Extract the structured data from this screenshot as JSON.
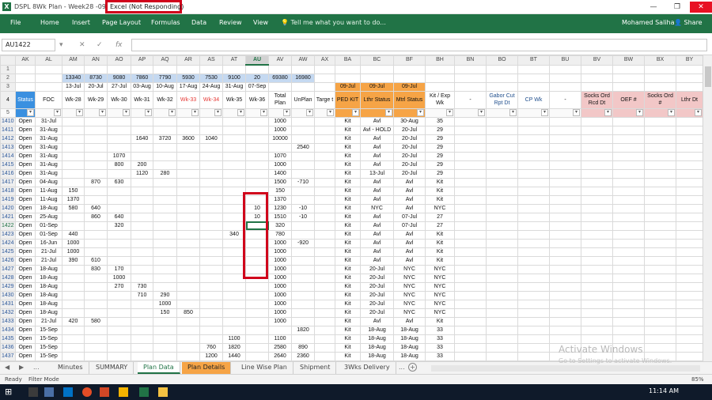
{
  "window": {
    "doc_title": "DSPL 8Wk Plan - Week28 -090718",
    "status": "Excel (Not Responding)",
    "app_letter": "X"
  },
  "ribbon": {
    "tabs": [
      "File",
      "Home",
      "Insert",
      "Page Layout",
      "Formulas",
      "Data",
      "Review",
      "View"
    ],
    "tell_me": "Tell me what you want to do...",
    "user": "Mohamed Saliha",
    "share": "Share"
  },
  "formula_bar": {
    "name_box": "AU1422",
    "cancel": "✕",
    "enter": "✓",
    "fx": "fx"
  },
  "columns": [
    "",
    "AK",
    "AL",
    "AM",
    "AN",
    "AO",
    "AP",
    "AQ",
    "AR",
    "AS",
    "AT",
    "AU",
    "AV",
    "AW",
    "AX",
    "BA",
    "BC",
    "BF",
    "BH",
    "BN",
    "BO",
    "BT",
    "BU",
    "BV",
    "BW",
    "BX",
    "BY"
  ],
  "row1_label": "1",
  "row2": {
    "label": "2",
    "AM": "13340",
    "AN": "8730",
    "AO": "9080",
    "AP": "7860",
    "AQ": "7790",
    "AR": "5930",
    "AS": "7530",
    "AT": "9100",
    "AU": "20",
    "AV": "69380",
    "AW": "16980"
  },
  "row3": {
    "label": "3",
    "AM": "13-Jul",
    "AN": "20-Jul",
    "AO": "27-Jul",
    "AP": "03-Aug",
    "AQ": "10-Aug",
    "AR": "17-Aug",
    "AS": "24-Aug",
    "AT": "31-Aug",
    "AU": "07-Sep",
    "BA": "09-Jul",
    "BC": "09-Jul",
    "BF": "09-Jul"
  },
  "headers": {
    "label": "4",
    "AK": "Status",
    "AL": "FOC",
    "AM": "Wk-28",
    "AN": "Wk-29",
    "AO": "Wk-30",
    "AP": "Wk-31",
    "AQ": "Wk-32",
    "AR": "Wk-33",
    "AS": "Wk-34",
    "AT": "Wk-35",
    "AU": "Wk-36",
    "AV": "Total Plan",
    "AW": "UnPlan",
    "AX": "Targe t",
    "BA": "PED KIT",
    "BC": "Lthr Status",
    "BF": "Mtrl Status",
    "BH": "Kit / Exp Wk",
    "BN": "-",
    "BO": "Gabor Cut Rpt Dt",
    "BT": "CP Wk",
    "BU": "-",
    "BV": "Socks Ord Rcd Dt",
    "BW": "OEF #",
    "BX": "Socks Ord #",
    "BY": "Lthr Dt"
  },
  "filter_row_label": "5",
  "rows": [
    [
      "1410",
      "Open",
      "31-Jul",
      "",
      "",
      "",
      "",
      "",
      "",
      "",
      "",
      "",
      "1000",
      "",
      "",
      "Kit",
      "Avl",
      "30-Aug",
      "35"
    ],
    [
      "1411",
      "Open",
      "31-Aug",
      "",
      "",
      "",
      "",
      "",
      "",
      "",
      "",
      "",
      "1000",
      "",
      "",
      "Kit",
      "Avl - HOLD",
      "20-Jul",
      "29"
    ],
    [
      "1412",
      "Open",
      "31-Aug",
      "",
      "",
      "",
      "1640",
      "3720",
      "3600",
      "1040",
      "",
      "",
      "10000",
      "",
      "",
      "Kit",
      "Avl",
      "20-Jul",
      "29"
    ],
    [
      "1413",
      "Open",
      "31-Aug",
      "",
      "",
      "",
      "",
      "",
      "",
      "",
      "",
      "",
      "",
      "2540",
      "",
      "Kit",
      "Avl",
      "20-Jul",
      "29"
    ],
    [
      "1414",
      "Open",
      "31-Aug",
      "",
      "",
      "1070",
      "",
      "",
      "",
      "",
      "",
      "",
      "1070",
      "",
      "",
      "Kit",
      "Avl",
      "20-Jul",
      "29"
    ],
    [
      "1415",
      "Open",
      "31-Aug",
      "",
      "",
      "800",
      "200",
      "",
      "",
      "",
      "",
      "",
      "1000",
      "",
      "",
      "Kit",
      "Avl",
      "20-Jul",
      "29"
    ],
    [
      "1416",
      "Open",
      "31-Aug",
      "",
      "",
      "",
      "1120",
      "280",
      "",
      "",
      "",
      "",
      "1400",
      "",
      "",
      "Kit",
      "13-Jul",
      "20-Jul",
      "29"
    ],
    [
      "1417",
      "Open",
      "04-Aug",
      "",
      "870",
      "630",
      "",
      "",
      "",
      "",
      "",
      "",
      "1500",
      "-710",
      "",
      "Kit",
      "Avl",
      "Avl",
      "Kit"
    ],
    [
      "1418",
      "Open",
      "11-Aug",
      "150",
      "",
      "",
      "",
      "",
      "",
      "",
      "",
      "",
      "150",
      "",
      "",
      "Kit",
      "Avl",
      "Avl",
      "Kit"
    ],
    [
      "1419",
      "Open",
      "11-Aug",
      "1370",
      "",
      "",
      "",
      "",
      "",
      "",
      "",
      "",
      "1370",
      "",
      "",
      "Kit",
      "Avl",
      "Avl",
      "Kit"
    ],
    [
      "1420",
      "Open",
      "18-Aug",
      "580",
      "640",
      "",
      "",
      "",
      "",
      "",
      "",
      "10",
      "1230",
      "-10",
      "",
      "Kit",
      "NYC",
      "Avl",
      "NYC"
    ],
    [
      "1421",
      "Open",
      "25-Aug",
      "",
      "860",
      "640",
      "",
      "",
      "",
      "",
      "",
      "10",
      "1510",
      "-10",
      "",
      "Kit",
      "Avl",
      "07-Jul",
      "27"
    ],
    [
      "1422",
      "Open",
      "01-Sep",
      "",
      "",
      "320",
      "",
      "",
      "",
      "",
      "",
      "",
      "320",
      "",
      "",
      "Kit",
      "Avl",
      "07-Jul",
      "27"
    ],
    [
      "1423",
      "Open",
      "01-Sep",
      "440",
      "",
      "",
      "",
      "",
      "",
      "",
      "340",
      "",
      "780",
      "",
      "",
      "Kit",
      "Avl",
      "Avl",
      "Kit"
    ],
    [
      "1424",
      "Open",
      "16-Jun",
      "1000",
      "",
      "",
      "",
      "",
      "",
      "",
      "",
      "",
      "1000",
      "-920",
      "",
      "Kit",
      "Avl",
      "Avl",
      "Kit"
    ],
    [
      "1425",
      "Open",
      "21-Jul",
      "1000",
      "",
      "",
      "",
      "",
      "",
      "",
      "",
      "",
      "1000",
      "",
      "",
      "Kit",
      "Avl",
      "Avl",
      "Kit"
    ],
    [
      "1426",
      "Open",
      "21-Jul",
      "390",
      "610",
      "",
      "",
      "",
      "",
      "",
      "",
      "",
      "1000",
      "",
      "",
      "Kit",
      "Avl",
      "Avl",
      "Kit"
    ],
    [
      "1427",
      "Open",
      "18-Aug",
      "",
      "830",
      "170",
      "",
      "",
      "",
      "",
      "",
      "",
      "1000",
      "",
      "",
      "Kit",
      "20-Jul",
      "NYC",
      "NYC"
    ],
    [
      "1428",
      "Open",
      "18-Aug",
      "",
      "",
      "1000",
      "",
      "",
      "",
      "",
      "",
      "",
      "1000",
      "",
      "",
      "Kit",
      "20-Jul",
      "NYC",
      "NYC"
    ],
    [
      "1429",
      "Open",
      "18-Aug",
      "",
      "",
      "270",
      "730",
      "",
      "",
      "",
      "",
      "",
      "1000",
      "",
      "",
      "Kit",
      "20-Jul",
      "NYC",
      "NYC"
    ],
    [
      "1430",
      "Open",
      "18-Aug",
      "",
      "",
      "",
      "710",
      "290",
      "",
      "",
      "",
      "",
      "1000",
      "",
      "",
      "Kit",
      "20-Jul",
      "NYC",
      "NYC"
    ],
    [
      "1431",
      "Open",
      "18-Aug",
      "",
      "",
      "",
      "",
      "1000",
      "",
      "",
      "",
      "",
      "1000",
      "",
      "",
      "Kit",
      "20-Jul",
      "NYC",
      "NYC"
    ],
    [
      "1432",
      "Open",
      "18-Aug",
      "",
      "",
      "",
      "",
      "150",
      "850",
      "",
      "",
      "",
      "1000",
      "",
      "",
      "Kit",
      "20-Jul",
      "NYC",
      "NYC"
    ],
    [
      "1433",
      "Open",
      "21-Jul",
      "420",
      "580",
      "",
      "",
      "",
      "",
      "",
      "",
      "",
      "1000",
      "",
      "",
      "Kit",
      "Avl",
      "Avl",
      "Kit"
    ],
    [
      "1434",
      "Open",
      "15-Sep",
      "",
      "",
      "",
      "",
      "",
      "",
      "",
      "",
      "",
      "",
      "1820",
      "",
      "Kit",
      "18-Aug",
      "18-Aug",
      "33"
    ],
    [
      "1435",
      "Open",
      "15-Sep",
      "",
      "",
      "",
      "",
      "",
      "",
      "",
      "1100",
      "",
      "1100",
      "",
      "",
      "Kit",
      "18-Aug",
      "18-Aug",
      "33"
    ],
    [
      "1436",
      "Open",
      "15-Sep",
      "",
      "",
      "",
      "",
      "",
      "",
      "760",
      "1820",
      "",
      "2580",
      "890",
      "",
      "Kit",
      "18-Aug",
      "18-Aug",
      "33"
    ],
    [
      "1437",
      "Open",
      "15-Sep",
      "",
      "",
      "",
      "",
      "",
      "",
      "1200",
      "1440",
      "",
      "2640",
      "2360",
      "",
      "Kit",
      "18-Aug",
      "18-Aug",
      "33"
    ]
  ],
  "sheet_tabs": [
    "Minutes",
    "SUMMARY",
    "Plan Data",
    "Plan Details",
    "Line Wise Plan",
    "Shipment",
    "3Wks Delivery"
  ],
  "sheet_nav": {
    "dots": "...",
    "prev": "◀",
    "next": "▶",
    "add": "+"
  },
  "watermark": {
    "line1": "Activate Windows",
    "line2": "Go to Settings to activate Windows."
  },
  "status": {
    "ready": "Ready",
    "mode": "Filter Mode",
    "zoom": "85%"
  },
  "taskbar": {
    "time": "11:14 AM"
  },
  "colors": {
    "excel_green": "#217346",
    "highlight_red": "#d0021b",
    "header_blue": "#3a90e0",
    "header_orange": "#f6a446",
    "header_pink": "#f2c7c7"
  }
}
